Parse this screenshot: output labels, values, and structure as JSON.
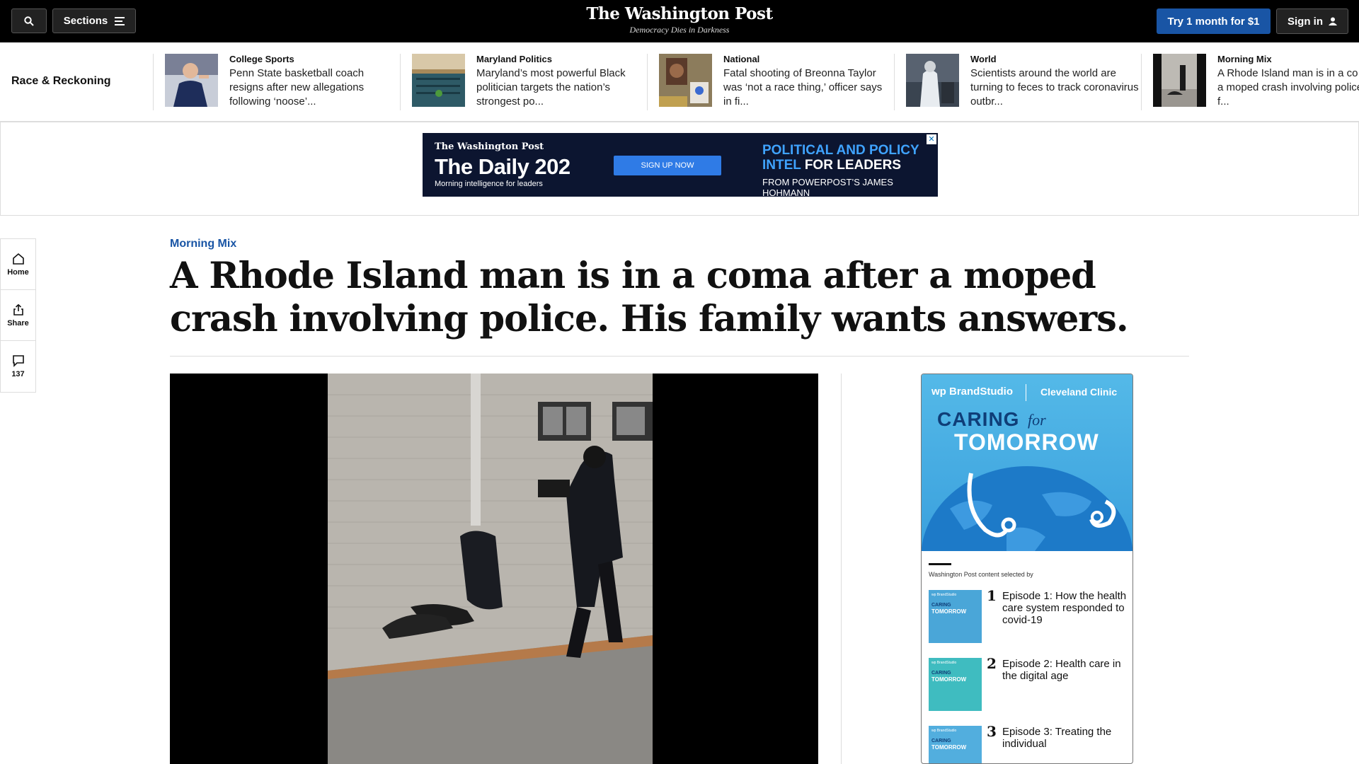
{
  "header": {
    "search_icon": "search-icon",
    "sections_label": "Sections",
    "logo_text": "The Washington Post",
    "tagline": "Democracy Dies in Darkness",
    "subscribe_label": "Try 1 month for $1",
    "signin_label": "Sign in"
  },
  "strip": {
    "label": "Race & Reckoning",
    "cards": [
      {
        "category": "College Sports",
        "headline": "Penn State basketball coach resigns after new allegations following ‘noose’..."
      },
      {
        "category": "Maryland Politics",
        "headline": "Maryland’s most powerful Black politician targets the nation’s strongest po..."
      },
      {
        "category": "National",
        "headline": "Fatal shooting of Breonna Taylor was ‘not a race thing,’ officer says in fi..."
      },
      {
        "category": "World",
        "headline": "Scientists around the world are turning to feces to track coronavirus outbr..."
      },
      {
        "category": "Morning Mix",
        "headline": "A Rhode Island man is in a co after a moped crash involving police. His f..."
      }
    ]
  },
  "banner_ad": {
    "logo": "The Washington Post",
    "title": "The Daily 202",
    "subtitle": "Morning intelligence for leaders",
    "button": "SIGN UP NOW",
    "right_line1a": "POLITICAL AND POLICY",
    "right_line1b": "INTEL",
    "right_line1c": "FOR LEADERS",
    "right_line2": "FROM POWERPOST’S JAMES HOHMANN",
    "close": "✕"
  },
  "rail": {
    "home_label": "Home",
    "share_label": "Share",
    "comments_count": "137"
  },
  "article": {
    "kicker": "Morning Mix",
    "headline": "A Rhode Island man is in a coma after a moped crash involving police. His family wants answers."
  },
  "side_ad": {
    "brand": "wp BrandStudio",
    "sponsor": "Cleveland Clinic",
    "caring": "CARING",
    "for": "for",
    "tomorrow": "TOMORROW",
    "selected_by": "Washington Post content selected by",
    "episodes": [
      {
        "num": "1",
        "title": "Episode 1: How the health care system responded to covid-19"
      },
      {
        "num": "2",
        "title": "Episode 2: Health care in the digital age"
      },
      {
        "num": "3",
        "title": "Episode 3: Treating the individual"
      }
    ]
  }
}
